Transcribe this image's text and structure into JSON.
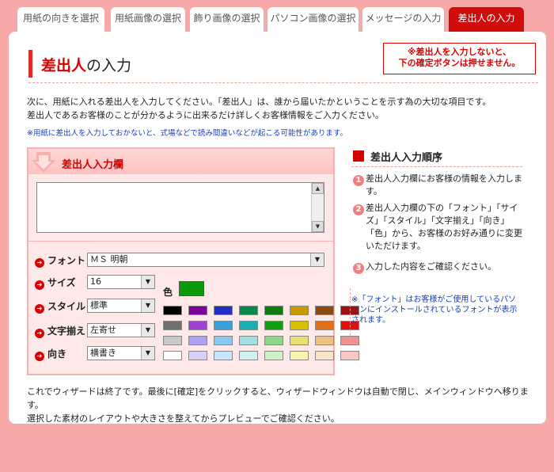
{
  "tabs": [
    {
      "label": "用紙の向きを選択",
      "active": false
    },
    {
      "label": "用紙画像の選択",
      "active": false
    },
    {
      "label": "飾り画像の選択",
      "active": false
    },
    {
      "label": "パソコン画像の選択",
      "active": false
    },
    {
      "label": "メッセージの入力",
      "active": false
    },
    {
      "label": "差出人の入力",
      "active": true
    }
  ],
  "page": {
    "title_highlight": "差出人",
    "title_rest": "の入力",
    "warning_line1": "※差出人を入力しないと、",
    "warning_line2": "下の確定ボタンは押せません。",
    "intro_line1": "次に、用紙に入れる差出人を入力してください。「差出人」は、誰から届いたかということを示す為の大切な項目です。",
    "intro_line2": "差出人であるお客様のことが分かるように出来るだけ詳しくお客様情報をご入力ください。",
    "small_note": "※用紙に差出人を入力しておかないと、式場などで読み間違いなどが起こる可能性があります。"
  },
  "input_box": {
    "heading": "差出人入力欄",
    "textarea_value": "",
    "font_label": "フォント",
    "font_value": "ＭＳ 明朝",
    "size_label": "サイズ",
    "size_value": "16",
    "style_label": "スタイル",
    "style_value": "標準",
    "align_label": "文字揃え",
    "align_value": "左寄せ",
    "direction_label": "向き",
    "direction_value": "横書き",
    "color_label": "色",
    "current_color": "#0a9a0a",
    "palette": [
      [
        "#000000",
        "#7a0099",
        "#2230c8",
        "#0a8a4a",
        "#0f7a0f",
        "#c89a00",
        "#8a4a10",
        "#a01010"
      ],
      [
        "#707070",
        "#a040d0",
        "#3aa0d8",
        "#18b0b0",
        "#10a010",
        "#d8c000",
        "#e07018",
        "#e01010"
      ],
      [
        "#c8c8c8",
        "#b0a0f0",
        "#88c8f0",
        "#a0e0e0",
        "#88d888",
        "#e8e070",
        "#f0c080",
        "#f09090"
      ],
      [
        "#ffffff",
        "#d8d0f8",
        "#c8e4f8",
        "#d0f0f0",
        "#d0f0c8",
        "#f8f4b0",
        "#f8e4c8",
        "#f8c8c8"
      ]
    ]
  },
  "order": {
    "title": "差出人入力順序",
    "steps": [
      {
        "num": "1",
        "text": "差出人入力欄にお客様の情報を入力します。"
      },
      {
        "num": "2",
        "text": "差出人入力欄の下の「フォント」「サイズ」「スタイル」「文字揃え」「向き」「色」から、お客様のお好み通りに変更いただけます。"
      },
      {
        "num": "3",
        "text": "入力した内容をご確認ください。"
      }
    ],
    "note": "※「フォント」はお客様がご使用しているパソコンにインストールされているフォントが表示されます。"
  },
  "footer": {
    "line1": "これでウィザードは終了です。最後に[確定]をクリックすると、ウィザードウィンドウは自動で閉じ、メインウィンドウへ移ります。",
    "line2": "選択した素材のレイアウトや大きさを整えてからプレビューでご確認ください。"
  }
}
